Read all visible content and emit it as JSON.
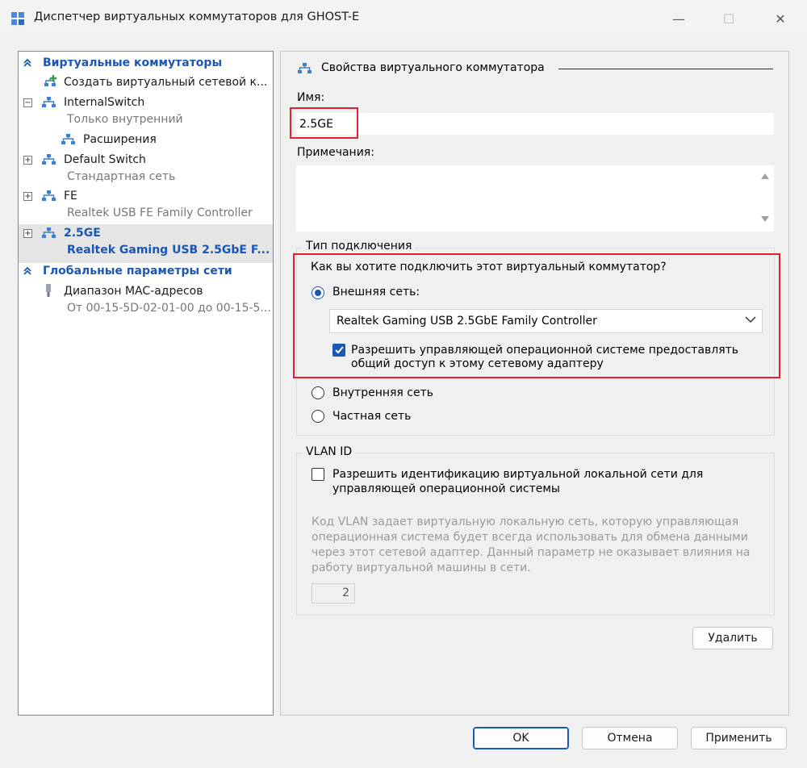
{
  "window": {
    "title": "Диспетчер виртуальных коммутаторов для GHOST-E",
    "minimize": "—",
    "maximize": "☐",
    "close": "✕"
  },
  "sidebar": {
    "section_switches": "Виртуальные коммутаторы",
    "create_switch": "Создать виртуальный сетевой к...",
    "items": [
      {
        "name": "InternalSwitch",
        "sub": "Только внутренний",
        "expander": "−"
      },
      {
        "name": "Расширения"
      },
      {
        "name": "Default Switch",
        "sub": "Стандартная сеть",
        "expander": "+"
      },
      {
        "name": "FE",
        "sub": "Realtek USB FE Family Controller",
        "expander": "+"
      },
      {
        "name": "2.5GE",
        "sub": "Realtek Gaming USB 2.5GbE F...",
        "expander": "+"
      }
    ],
    "section_global": "Глобальные параметры сети",
    "mac_range": {
      "name": "Диапазон MAC-адресов",
      "sub": "От 00-15-5D-02-01-00 до 00-15-5..."
    },
    "chevron": "≈"
  },
  "props": {
    "header": "Свойства виртуального коммутатора",
    "name_label": "Имя:",
    "name_value": "2.5GE",
    "notes_label": "Примечания:",
    "notes_value": "",
    "conn_type_legend": "Тип подключения",
    "conn_question": "Как вы хотите подключить этот виртуальный коммутатор?",
    "external_label": "Внешняя сеть:",
    "adapter_selected": "Realtek Gaming USB 2.5GbE Family Controller",
    "allow_mgmt_line1": "Разрешить управляющей операционной системе предоставлять",
    "allow_mgmt_line2": "общий доступ к этому сетевому адаптеру",
    "internal_label": "Внутренняя сеть",
    "private_label": "Частная сеть",
    "vlan_legend": "VLAN ID",
    "vlan_enable_line1": "Разрешить идентификацию виртуальной локальной сети для",
    "vlan_enable_line2": "управляющей операционной системы",
    "vlan_desc_1": "Код VLAN задает виртуальную локальную сеть, которую управляющая",
    "vlan_desc_2": "операционная система будет всегда использовать для обмена данными",
    "vlan_desc_3": "через этот сетевой адаптер. Данный параметр не оказывает влияния на",
    "vlan_desc_4": "работу виртуальной машины в сети.",
    "vlan_value": "2",
    "delete_btn": "Удалить"
  },
  "footer": {
    "ok": "OK",
    "cancel": "Отмена",
    "apply": "Применить"
  },
  "state": {
    "connection": "external",
    "allow_mgmt_checked": true,
    "vlan_checked": false
  },
  "colors": {
    "accent": "#1a56b4",
    "highlight_red": "#e0212e"
  }
}
